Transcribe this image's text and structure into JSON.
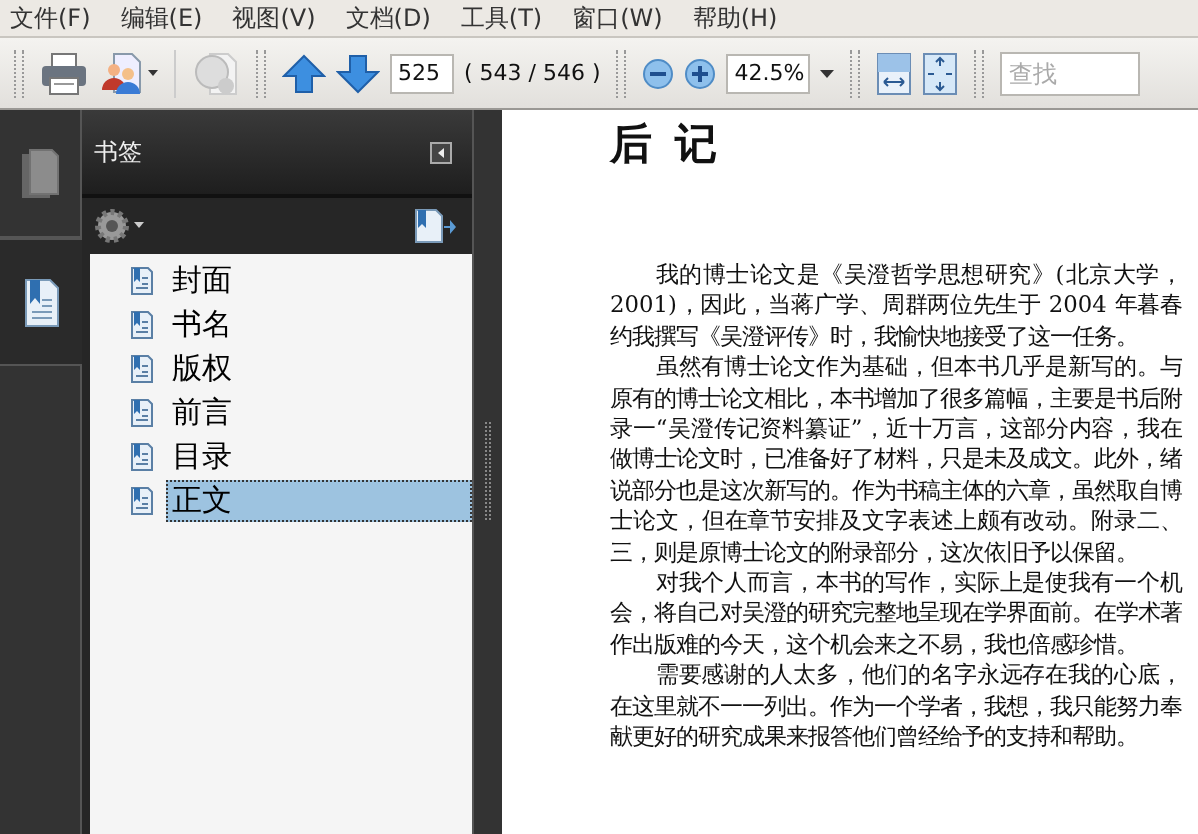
{
  "menu": [
    "文件(F)",
    "编辑(E)",
    "视图(V)",
    "文档(D)",
    "工具(T)",
    "窗口(W)",
    "帮助(H)"
  ],
  "toolbar": {
    "page_field": "525",
    "page_count": "( 543 / 546 )",
    "zoom_field": "42.5%",
    "search": {
      "placeholder": "查找"
    }
  },
  "rail_tabs": [
    {
      "kind": "pages",
      "selected": false
    },
    {
      "kind": "bookmarks",
      "selected": true
    }
  ],
  "bookmarks_panel": {
    "title": "书签",
    "items": [
      {
        "label": "封面",
        "selected": false
      },
      {
        "label": "书名",
        "selected": false
      },
      {
        "label": "版权",
        "selected": false
      },
      {
        "label": "前言",
        "selected": false
      },
      {
        "label": "目录",
        "selected": false
      },
      {
        "label": "正文",
        "selected": true
      }
    ]
  },
  "document": {
    "title": "后 记",
    "paragraphs": [
      "我的博士论文是《吴澄哲学思想研究》(北京大学，2001)，因此，当蒋广学、周群两位先生于 2004 年暮春约我撰写《吴澄评传》时，我愉快地接受了这一任务。",
      "虽然有博士论文作为基础，但本书几乎是新写的。与原有的博士论文相比，本书增加了很多篇幅，主要是书后附录一“吴澄传记资料纂证”，近十万言，这部分内容，我在做博士论文时，已准备好了材料，只是未及成文。此外，绪说部分也是这次新写的。作为书稿主体的六章，虽然取自博士论文，但在章节安排及文字表述上颇有改动。附录二、三，则是原博士论文的附录部分，这次依旧予以保留。",
      "对我个人而言，本书的写作，实际上是使我有一个机会，将自己对吴澄的研究完整地呈现在学界面前。在学术著作出版难的今天，这个机会来之不易，我也倍感珍惜。",
      "需要感谢的人太多，他们的名字永远存在我的心底，在这里就不一一列出。作为一个学者，我想，我只能努力奉献更好的研究成果来报答他们曾经给予的支持和帮助。"
    ]
  }
}
